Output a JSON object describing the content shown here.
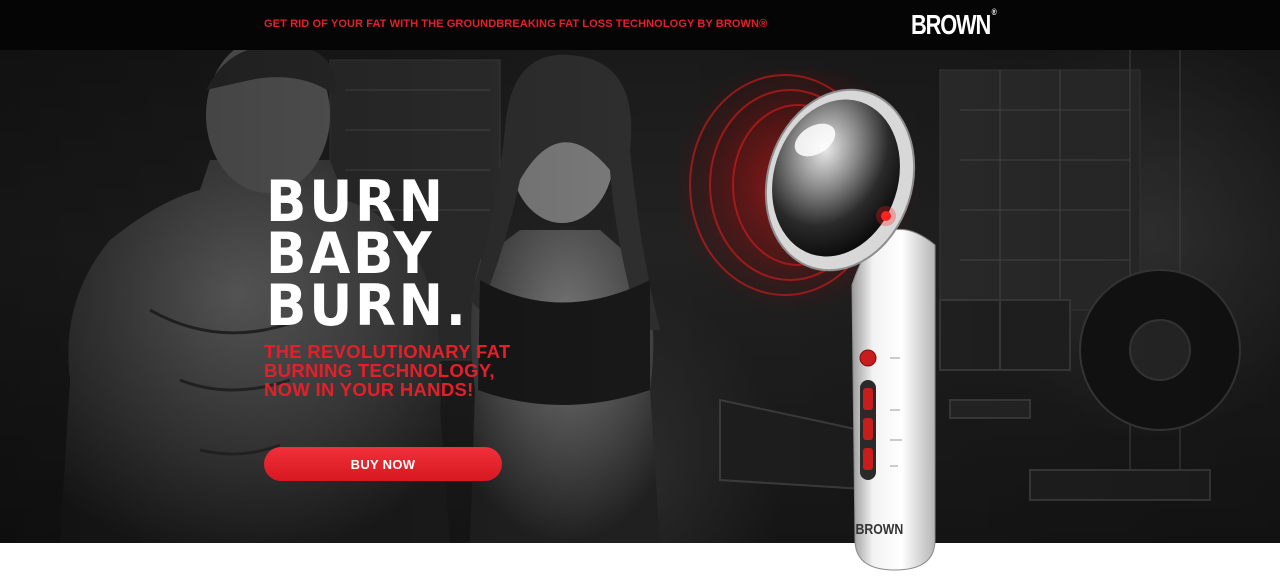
{
  "topbar": {
    "promo_text": "GET RID OF YOUR FAT WITH THE GROUNDBREAKING FAT LOSS TECHNOLOGY BY BROWN®",
    "logo_text": "BROWN",
    "logo_mark": "®"
  },
  "hero": {
    "headline": [
      "BURN",
      "BABY",
      "BURN."
    ],
    "subheadline": [
      "THE REVOLUTIONARY FAT",
      "BURNING TECHNOLOGY,",
      "NOW IN YOUR HANDS!"
    ],
    "cta_label": "BUY NOW",
    "device_brand": "BROWN"
  },
  "colors": {
    "accent": "#e3202a",
    "topbar_bg": "#050505",
    "text_light": "#ffffff"
  },
  "icons": [
    "brand-logo",
    "device-power-button",
    "device-control-buttons"
  ]
}
